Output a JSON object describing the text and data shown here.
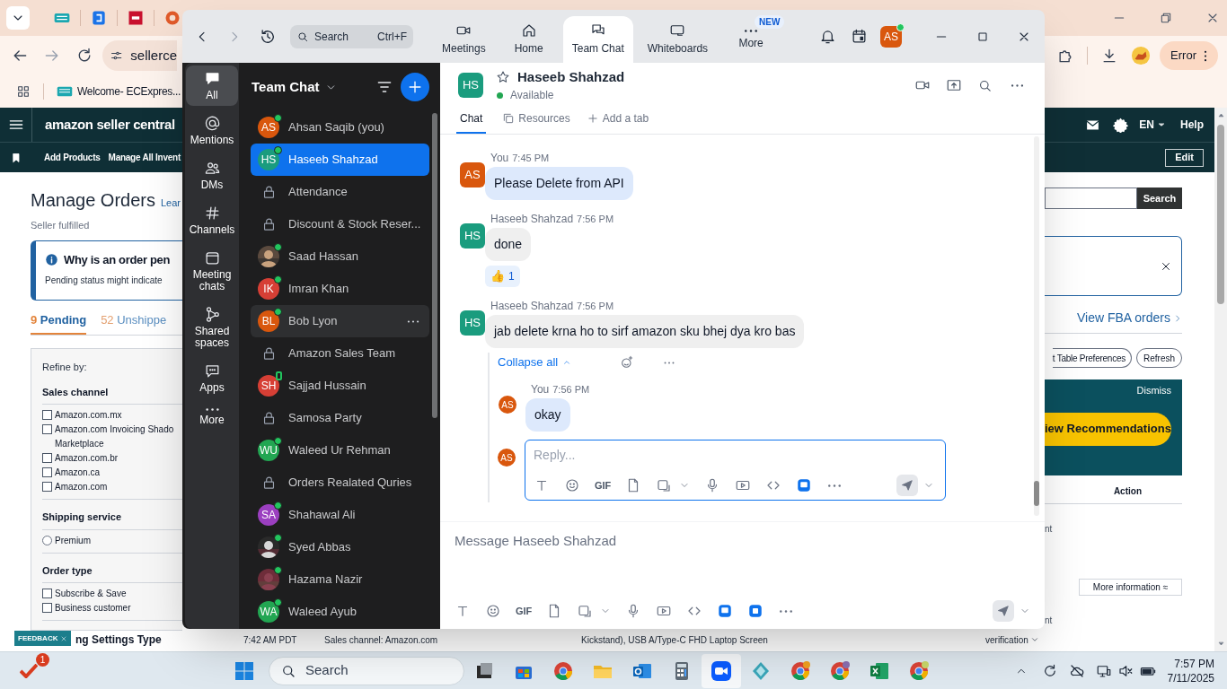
{
  "browser": {
    "address": "sellerce",
    "bookmark": "Welcome- ECExpres...",
    "error_button": "Error"
  },
  "seller_page": {
    "brand": "amazon seller central",
    "nav": [
      "Add Products",
      "Manage All Invent"
    ],
    "language": "EN",
    "help": "Help",
    "edit_button": "Edit",
    "title": "Manage Orders",
    "learn_link": "Lear",
    "subtitle": "Seller fulfilled",
    "search_button": "Search",
    "alert": {
      "title": "Why is an order pen",
      "text": "Pending status might indicate"
    },
    "order_tabs": [
      {
        "count": "9",
        "label": "Pending",
        "selected": true
      },
      {
        "count": "52",
        "label": "Unshippe",
        "selected": false
      }
    ],
    "view_fba": "View FBA orders",
    "toolbar_buttons": [
      "t Table Preferences",
      "Refresh"
    ],
    "banner": {
      "dismiss": "Dismiss",
      "button": "iew Recommendations"
    },
    "action_header": "Action",
    "row_fragments": [
      "nt",
      "nt"
    ],
    "more_info": "More information ≈",
    "refine": {
      "title": "Refine by:",
      "sections": [
        {
          "title": "Sales channel",
          "kind": "checkbox",
          "options": [
            {
              "label": "Amazon.com.mx",
              "checked": false
            },
            {
              "label": "Amazon.com Invoicing Shado\nMarketplace",
              "checked": false
            },
            {
              "label": "Amazon.com.br",
              "checked": false
            },
            {
              "label": "Amazon.ca",
              "checked": false
            },
            {
              "label": "Amazon.com",
              "checked": false
            }
          ]
        },
        {
          "title": "Shipping service",
          "kind": "radio",
          "options": [
            {
              "label": "Premium",
              "checked": false
            }
          ]
        },
        {
          "title": "Order type",
          "kind": "checkbox",
          "options": [
            {
              "label": "Subscribe & Save",
              "checked": false
            },
            {
              "label": "Business customer",
              "checked": false
            }
          ]
        }
      ]
    },
    "bottom_row": {
      "section": "ng Settings Type",
      "time": "7:42 AM PDT",
      "channel": "Sales channel: Amazon.com",
      "product": "Kickstand), USB A/Type-C FHD Laptop Screen",
      "status": "verification"
    },
    "feedback": "FEEDBACK"
  },
  "zoom": {
    "search": {
      "placeholder": "Search",
      "shortcut": "Ctrl+F"
    },
    "top_tabs": [
      {
        "label": "Meetings",
        "kind": "meetings",
        "selected": false
      },
      {
        "label": "Home",
        "kind": "home",
        "selected": false
      },
      {
        "label": "Team Chat",
        "kind": "chat",
        "selected": true
      },
      {
        "label": "Whiteboards",
        "kind": "whiteboard",
        "selected": false
      },
      {
        "label": "More",
        "kind": "more",
        "badge": "NEW",
        "selected": false
      }
    ],
    "profile": {
      "initials": "AS",
      "color": "#d9570d"
    },
    "rail": [
      {
        "label": "All",
        "kind": "all",
        "selected": true
      },
      {
        "label": "Mentions",
        "kind": "mentions",
        "selected": false
      },
      {
        "label": "DMs",
        "kind": "dms",
        "selected": false
      },
      {
        "label": "Channels",
        "kind": "channels",
        "selected": false
      },
      {
        "label": "Meeting chats",
        "kind": "meetings",
        "selected": false
      },
      {
        "label": "Shared spaces",
        "kind": "spaces",
        "selected": false
      },
      {
        "label": "Apps",
        "kind": "apps",
        "selected": false
      },
      {
        "label": "More",
        "kind": "more",
        "selected": false
      }
    ],
    "list_title": "Team Chat",
    "chats": [
      {
        "kind": "person",
        "initials": "AS",
        "color": "#d9570d",
        "name": "Ahsan Saqib (you)",
        "online": true,
        "mobile": false,
        "selected": false,
        "hovered": false
      },
      {
        "kind": "person",
        "initials": "HS",
        "color": "#1a9c7e",
        "name": "Haseeb Shahzad",
        "online": true,
        "mobile": false,
        "selected": true,
        "hovered": false
      },
      {
        "kind": "channel",
        "name": "Attendance",
        "selected": false,
        "hovered": false
      },
      {
        "kind": "channel",
        "name": "Discount & Stock Reser...",
        "selected": false,
        "hovered": false
      },
      {
        "name": "Saad Hassan",
        "online": true,
        "mobile": false,
        "selected": false,
        "hovered": false
      },
      {
        "kind": "person",
        "initials": "IK",
        "color": "#d63f35",
        "name": "Imran Khan",
        "online": true,
        "mobile": false,
        "selected": false,
        "hovered": false
      },
      {
        "kind": "person",
        "initials": "BL",
        "color": "#d9570d",
        "name": "Bob Lyon",
        "online": true,
        "mobile": false,
        "selected": false,
        "hovered": true
      },
      {
        "kind": "channel",
        "name": "Amazon Sales Team",
        "selected": false,
        "hovered": false
      },
      {
        "kind": "person",
        "initials": "SH",
        "color": "#d63f35",
        "name": "Sajjad Hussain",
        "online": false,
        "mobile": true,
        "selected": false,
        "hovered": false
      },
      {
        "kind": "channel",
        "name": "Samosa Party",
        "selected": false,
        "hovered": false
      },
      {
        "kind": "person",
        "initials": "WU",
        "color": "#22a652",
        "name": "Waleed Ur Rehman",
        "online": true,
        "mobile": false,
        "selected": false,
        "hovered": false
      },
      {
        "kind": "channel",
        "name": "Orders Realated Quries",
        "selected": false,
        "hovered": false
      },
      {
        "kind": "person",
        "initials": "SA",
        "color": "#9b3fc0",
        "name": "Shahawal Ali",
        "online": true,
        "mobile": false,
        "selected": false,
        "hovered": false
      },
      {
        "name": "Syed Abbas",
        "online": true,
        "mobile": false,
        "selected": false,
        "hovered": false
      },
      {
        "name": "Hazama Nazir",
        "online": true,
        "mobile": false,
        "selected": false,
        "hovered": false
      },
      {
        "kind": "person",
        "initials": "WA",
        "color": "#22a652",
        "name": "Waleed Ayub",
        "online": true,
        "mobile": false,
        "selected": false,
        "hovered": false
      }
    ],
    "conversation": {
      "initials": "HS",
      "color": "#1a9c7e",
      "name": "Haseeb Shahzad",
      "status": "Available",
      "tabs": [
        {
          "label": "Chat",
          "kind": "chat",
          "selected": true
        },
        {
          "label": "Resources",
          "kind": "resources",
          "selected": false
        },
        {
          "label": "Add a tab",
          "kind": "add",
          "selected": false
        }
      ],
      "messages": [
        {
          "sender": "You",
          "time": "7:45 PM",
          "initials": "AS",
          "color": "#d9570d",
          "mine": true,
          "text": "Please Delete from API"
        },
        {
          "sender": "Haseeb Shahzad",
          "time": "7:56 PM",
          "initials": "HS",
          "color": "#1a9c7e",
          "mine": false,
          "text": "done",
          "reaction": {
            "emoji": "👍",
            "count": "1"
          }
        },
        {
          "sender": "Haseeb Shahzad",
          "time": "7:56 PM",
          "initials": "HS",
          "color": "#1a9c7e",
          "mine": false,
          "text": "jab delete krna ho to sirf amazon sku bhej dya kro bas",
          "thread": {
            "collapse": "Collapse all",
            "replies": [
              {
                "sender": "You",
                "time": "7:56 PM",
                "initials": "AS",
                "color": "#d9570d",
                "mine": true,
                "text": "okay"
              }
            ],
            "reply": {
              "initials": "AS",
              "color": "#d9570d",
              "placeholder": "Reply...",
              "gif": "GIF"
            }
          }
        }
      ],
      "composer": {
        "placeholder": "Message Haseeb Shahzad",
        "gif": "GIF"
      }
    }
  },
  "taskbar": {
    "badge": "1",
    "search": "Search",
    "time": "7:57 PM",
    "date": "7/11/2025"
  }
}
